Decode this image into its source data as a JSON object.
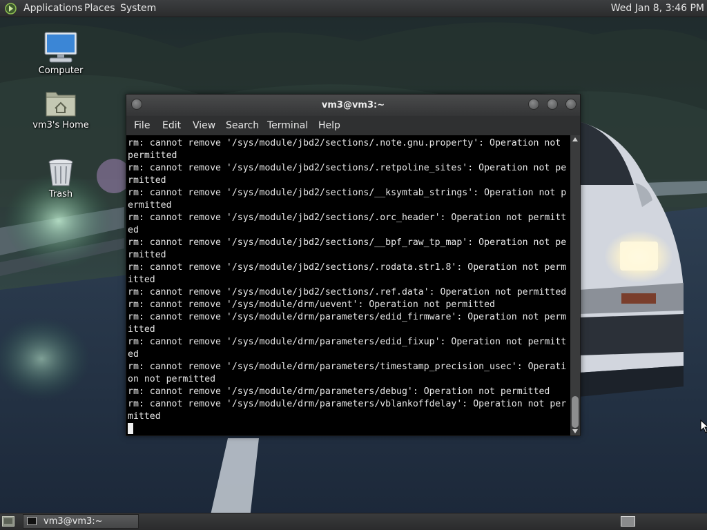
{
  "top_panel": {
    "menus": [
      "Applications",
      "Places",
      "System"
    ],
    "clock": "Wed Jan  8,  3:46 PM"
  },
  "desktop": {
    "icons": [
      {
        "label": "Computer",
        "icon": "computer-icon"
      },
      {
        "label": "vm3's Home",
        "icon": "home-folder-icon"
      },
      {
        "label": "Trash",
        "icon": "trash-icon"
      }
    ]
  },
  "terminal": {
    "title": "vm3@vm3:~",
    "menus": [
      "File",
      "Edit",
      "View",
      "Search",
      "Terminal",
      "Help"
    ],
    "lines": [
      "rm: cannot remove '/sys/module/jbd2/sections/.note.gnu.property': Operation not",
      "permitted",
      "rm: cannot remove '/sys/module/jbd2/sections/.retpoline_sites': Operation not pe",
      "rmitted",
      "rm: cannot remove '/sys/module/jbd2/sections/__ksymtab_strings': Operation not p",
      "ermitted",
      "rm: cannot remove '/sys/module/jbd2/sections/.orc_header': Operation not permitt",
      "ed",
      "rm: cannot remove '/sys/module/jbd2/sections/__bpf_raw_tp_map': Operation not pe",
      "rmitted",
      "rm: cannot remove '/sys/module/jbd2/sections/.rodata.str1.8': Operation not perm",
      "itted",
      "rm: cannot remove '/sys/module/jbd2/sections/.ref.data': Operation not permitted",
      "rm: cannot remove '/sys/module/drm/uevent': Operation not permitted",
      "rm: cannot remove '/sys/module/drm/parameters/edid_firmware': Operation not perm",
      "itted",
      "rm: cannot remove '/sys/module/drm/parameters/edid_fixup': Operation not permitt",
      "ed",
      "rm: cannot remove '/sys/module/drm/parameters/timestamp_precision_usec': Operati",
      "on not permitted",
      "rm: cannot remove '/sys/module/drm/parameters/debug': Operation not permitted",
      "rm: cannot remove '/sys/module/drm/parameters/vblankoffdelay': Operation not per",
      "mitted"
    ]
  },
  "taskbar": {
    "window_button": "vm3@vm3:~"
  },
  "colors": {
    "panel": "#2f3031",
    "terminal_bg": "#000000",
    "terminal_fg": "#e8e8e8"
  }
}
